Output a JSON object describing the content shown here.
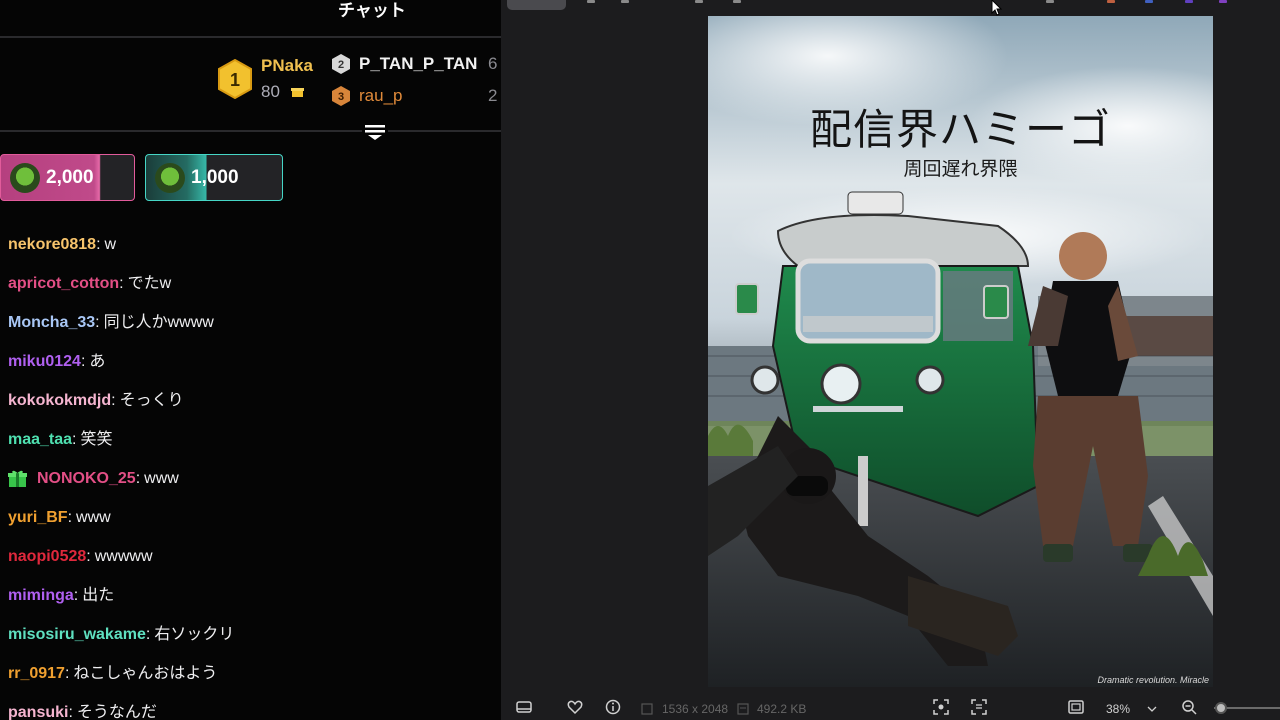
{
  "chat": {
    "title": "チャット",
    "leaderboard": {
      "first": {
        "rank": "1",
        "name": "PNaka",
        "score": "80"
      },
      "second": {
        "rank": "2",
        "name": "P_TAN_P_TAN",
        "value": "6"
      },
      "third": {
        "rank": "3",
        "name": "rau_p",
        "value": "2"
      }
    },
    "hype_trains": [
      {
        "amount": "2,000",
        "fill": 0.7
      },
      {
        "amount": "1,000",
        "fill": 0.45
      }
    ],
    "messages": [
      {
        "user": "nekore0818",
        "text": "w",
        "color": "#f7c46c"
      },
      {
        "user": "apricot_cotton",
        "text": "でたw",
        "color": "#e34f86"
      },
      {
        "user": "Moncha_33",
        "text": "同じ人かwwww",
        "color": "#a9c7f5"
      },
      {
        "user": "miku0124",
        "text": "あ",
        "color": "#b060f0"
      },
      {
        "user": "kokokokmdjd",
        "text": "そっくり",
        "color": "#f5b5d0"
      },
      {
        "user": "maa_taa",
        "text": "笑笑",
        "color": "#4fe0b0"
      },
      {
        "user": "NONOKO_25",
        "text": "www",
        "color": "#e34f86",
        "badge": "gift-sub-badge-icon"
      },
      {
        "user": "yuri_BF",
        "text": "www",
        "color": "#f0a030"
      },
      {
        "user": "naopi0528",
        "text": "wwwww",
        "color": "#e0283c"
      },
      {
        "user": "miminga",
        "text": "出た",
        "color": "#b060f0"
      },
      {
        "user": "misosiru_wakame",
        "text": "右ソックリ",
        "color": "#5fe0c0"
      },
      {
        "user": "rr_0917",
        "text": "ねこしゃんおはよう",
        "color": "#f0a030"
      },
      {
        "user": "pansuki",
        "text": "そうなんだ",
        "color": "#f5b5d0"
      }
    ]
  },
  "viewer": {
    "poster": {
      "title": "配信界ハミーゴ",
      "subtitle": "周回遅れ界隈",
      "credit": "Dramatic revolution. Miracle"
    },
    "toolbar": {
      "dimensions": "1536 x 2048",
      "file_size": "492.2 KB",
      "zoom": "38%"
    }
  }
}
